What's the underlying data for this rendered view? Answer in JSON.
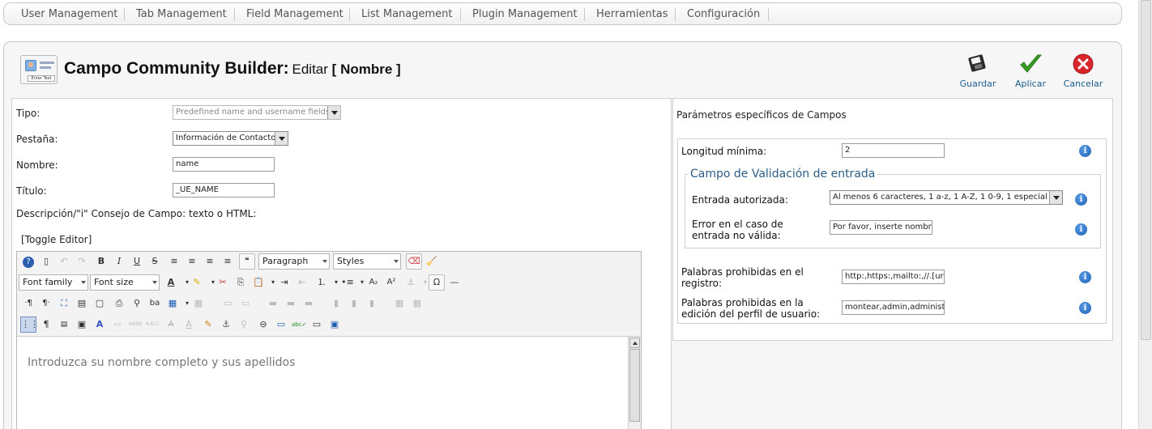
{
  "top_menu": {
    "items": [
      {
        "label": "User Management"
      },
      {
        "label": "Tab Management"
      },
      {
        "label": "Field Management"
      },
      {
        "label": "List Management"
      },
      {
        "label": "Plugin Management"
      },
      {
        "label": "Herramientas"
      },
      {
        "label": "Configuración"
      }
    ]
  },
  "header": {
    "icon_button_text": "Enter Text",
    "title_main": "Campo Community Builder:",
    "title_action": "Editar",
    "title_open": "[",
    "title_name": "Nombre",
    "title_close": "]"
  },
  "toolbar": {
    "save_label": "Guardar",
    "apply_label": "Aplicar",
    "cancel_label": "Cancelar"
  },
  "form": {
    "tipo_label": "Tipo:",
    "tipo_value": "Predefined name and username fields",
    "pestana_label": "Pestaña:",
    "pestana_value": "Información de Contacto",
    "nombre_label": "Nombre:",
    "nombre_value": "name",
    "titulo_label": "Título:",
    "titulo_value": "_UE_NAME",
    "descripcion_label": "Descripción/\"i\" Consejo de Campo: texto o HTML:",
    "toggle_editor": "[Toggle Editor]"
  },
  "editor": {
    "format_value": "Paragraph",
    "styles_value": "Styles",
    "font_family_value": "Font family",
    "font_size_value": "Font size",
    "content": "Introduzca su nombre completo y sus apellidos"
  },
  "params": {
    "title": "Parámetros específicos de Campos",
    "longitud_label": "Longitud mínima:",
    "longitud_value": "2",
    "fieldset_legend": "Campo de Validación de entrada",
    "entrada_label": "Entrada autorizada:",
    "entrada_value": "Al menos 6 caracteres, 1 a-z, 1 A-Z, 1 0-9, 1 especial",
    "error_label_1": "Error en el caso de",
    "error_label_2": "entrada no válida:",
    "error_value": "Por favor, inserte nombre",
    "palabras_reg_label_1": "Palabras prohibidas en el",
    "palabras_reg_label_2": "registro:",
    "palabras_reg_value": "http:,https:,mailto:,//.[url],<a",
    "palabras_edit_label_1": "Palabras prohibidas en la",
    "palabras_edit_label_2": "edición del perfil de usuario:",
    "palabras_edit_value": "montear,admin,administrador"
  },
  "colors": {
    "link_blue": "#1a5d8f",
    "legend_blue": "#2c5d86",
    "info_blue": "#1a5fb4"
  }
}
